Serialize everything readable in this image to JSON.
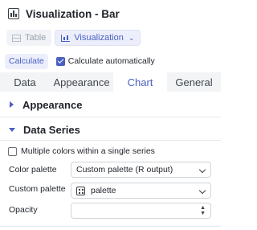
{
  "header": {
    "title": "Visualization - Bar",
    "icon": "bar-chart-icon"
  },
  "toolbar": {
    "table_label": "Table",
    "visualization_label": "Visualization",
    "dropdown_icon": "chevron-down-icon"
  },
  "calc": {
    "button_label": "Calculate",
    "auto_label": "Calculate automatically",
    "auto_checked": true
  },
  "tabs": [
    {
      "label": "Data",
      "active": false
    },
    {
      "label": "Appearance",
      "active": false
    },
    {
      "label": "Chart",
      "active": true
    },
    {
      "label": "General",
      "active": false
    }
  ],
  "sections": {
    "appearance": {
      "title": "Appearance",
      "expanded": false
    },
    "data_series": {
      "title": "Data Series",
      "expanded": true
    }
  },
  "data_series": {
    "multi_colors_label": "Multiple colors within a single series",
    "multi_colors_checked": false,
    "color_palette_label": "Color palette",
    "color_palette_value": "Custom palette (R output)",
    "custom_palette_label": "Custom palette",
    "custom_palette_value": "palette",
    "custom_palette_icon": "table-icon",
    "opacity_label": "Opacity",
    "opacity_value": ""
  },
  "colors": {
    "accent": "#4a5fc1",
    "tab_bg": "#f3f4f6",
    "text": "#1f2329"
  }
}
